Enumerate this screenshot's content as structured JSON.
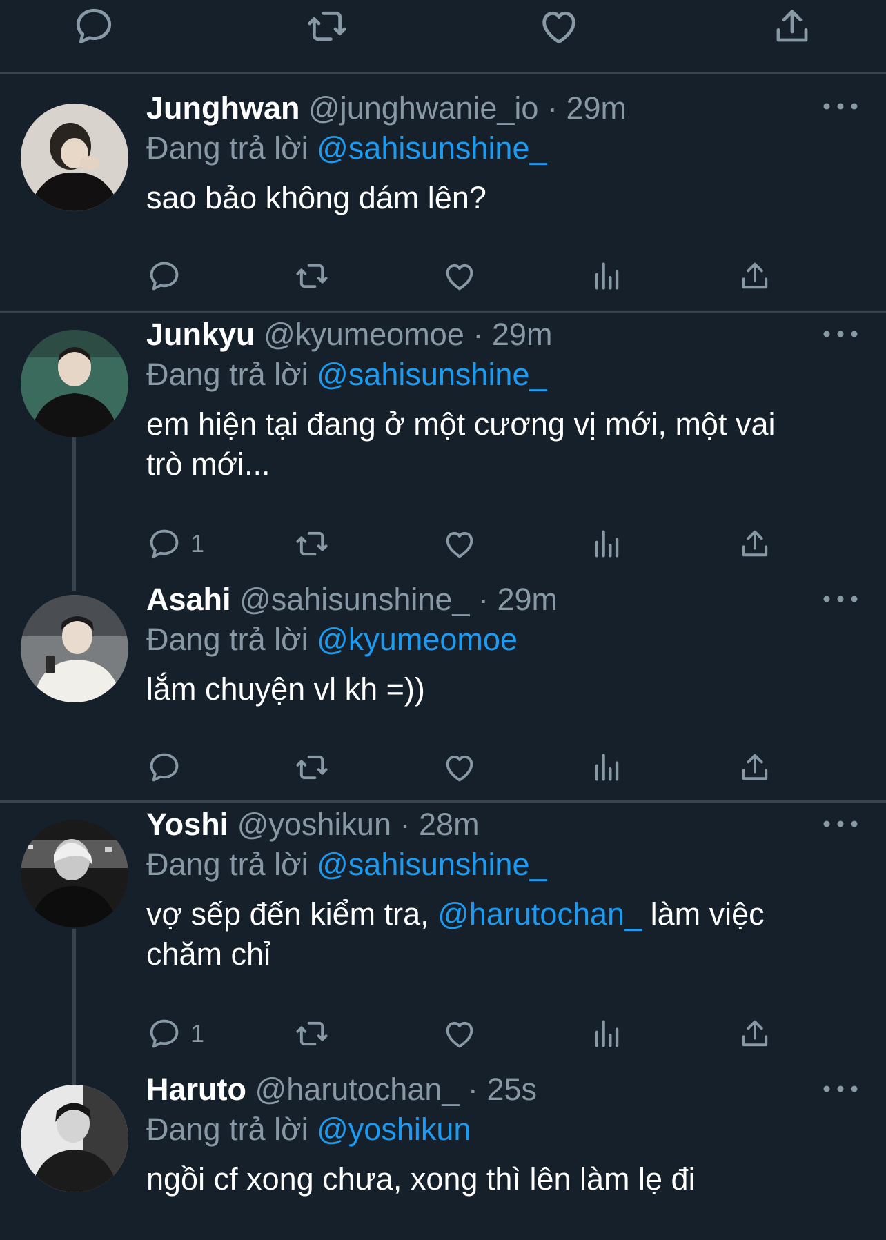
{
  "icons": {
    "reply": "reply-icon",
    "retweet": "retweet-icon",
    "like": "heart-icon",
    "share": "share-icon",
    "views": "analytics-icon",
    "more": "more-icon"
  },
  "colors": {
    "background": "#15202b",
    "divider": "#38444d",
    "secondary_text": "#8899a6",
    "mention": "#1d9bf0",
    "icon": "#8899a6"
  },
  "replying_label": "Đang trả lời",
  "replies": [
    {
      "name": "Junghwan",
      "handle": "@junghwanie_io",
      "separator": "·",
      "time": "29m",
      "replying_to": "@sahisunshine_",
      "text_before": "sao bảo không dám lên?",
      "mention": "",
      "text_after": "",
      "text_line2": "",
      "reply_count": ""
    },
    {
      "name": "Junkyu",
      "handle": "@kyumeomoe",
      "separator": "·",
      "time": "29m",
      "replying_to": "@sahisunshine_",
      "text_before": "em hiện tại đang ở một cương vị mới, một vai",
      "mention": "",
      "text_after": "",
      "text_line2": "trò mới...",
      "reply_count": "1"
    },
    {
      "name": "Asahi",
      "handle": "@sahisunshine_",
      "separator": "·",
      "time": "29m",
      "replying_to": "@kyumeomoe",
      "text_before": "lắm chuyện vl kh =))",
      "mention": "",
      "text_after": "",
      "text_line2": "",
      "reply_count": ""
    },
    {
      "name": "Yoshi",
      "handle": "@yoshikun",
      "separator": "·",
      "time": "28m",
      "replying_to": "@sahisunshine_",
      "text_before": "vợ sếp đến kiểm tra, ",
      "mention": "@harutochan_",
      "text_after": " làm việc",
      "text_line2": "chăm chỉ",
      "reply_count": "1"
    },
    {
      "name": "Haruto",
      "handle": "@harutochan_",
      "separator": "·",
      "time": "25s",
      "replying_to": "@yoshikun",
      "text_before": "ngồi cf xong chưa, xong thì lên làm lẹ đi",
      "mention": "",
      "text_after": "",
      "text_line2": "",
      "reply_count": ""
    }
  ]
}
